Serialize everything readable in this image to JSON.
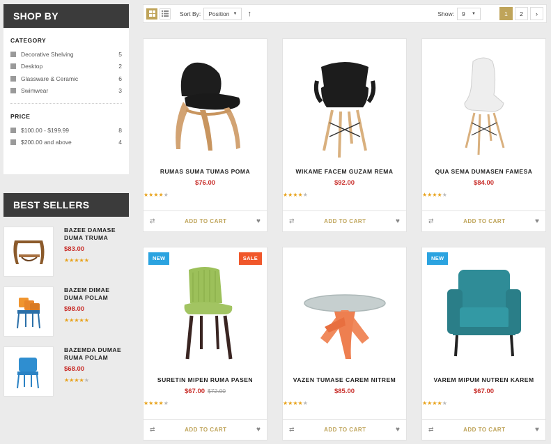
{
  "sidebar": {
    "shop_by_title": "SHOP BY",
    "category_heading": "CATEGORY",
    "categories": [
      {
        "label": "Decorative Shelving",
        "count": "5"
      },
      {
        "label": "Desktop",
        "count": "2"
      },
      {
        "label": "Glassware & Ceramic",
        "count": "6"
      },
      {
        "label": "Swimwear",
        "count": "3"
      }
    ],
    "price_heading": "PRICE",
    "prices": [
      {
        "label": "$100.00 - $199.99",
        "count": "8"
      },
      {
        "label": "$200.00 and above",
        "count": "4"
      }
    ],
    "best_sellers_title": "BEST SELLERS",
    "best_sellers": [
      {
        "name": "BAZEE DAMASE DUMA TRUMA",
        "price": "$83.00",
        "rating": 5
      },
      {
        "name": "BAZEM DIMAE DUMA POLAM",
        "price": "$98.00",
        "rating": 5
      },
      {
        "name": "BAZEMDA DUMAE RUMA POLAM",
        "price": "$68.00",
        "rating": 4
      }
    ]
  },
  "toolbar": {
    "sort_label": "Sort By:",
    "sort_value": "Position",
    "show_label": "Show:",
    "show_value": "9",
    "pages": [
      "1",
      "2"
    ],
    "current_page": "1",
    "next_icon": "chevron-right-icon"
  },
  "colors": {
    "accent": "#bfa45a",
    "price": "#c9302c",
    "new_badge": "#2ba3e0",
    "sale_badge": "#f0572b",
    "star": "#e8a21a"
  },
  "products": [
    {
      "name": "RUMAS SUMA TUMAS POMA",
      "price": "$76.00",
      "old_price": "",
      "rating": 4,
      "badge_new": "",
      "badge_sale": ""
    },
    {
      "name": "WIKAME FACEM GUZAM REMA",
      "price": "$92.00",
      "old_price": "",
      "rating": 4,
      "badge_new": "",
      "badge_sale": ""
    },
    {
      "name": "QUA SEMA DUMASEN FAMESA",
      "price": "$84.00",
      "old_price": "",
      "rating": 4,
      "badge_new": "",
      "badge_sale": ""
    },
    {
      "name": "SURETIN MIPEN RUMA PASEN",
      "price": "$67.00",
      "old_price": "$72.00",
      "rating": 4,
      "badge_new": "NEW",
      "badge_sale": "SALE"
    },
    {
      "name": "VAZEN TUMASE CAREM NITREM",
      "price": "$85.00",
      "old_price": "",
      "rating": 4,
      "badge_new": "",
      "badge_sale": ""
    },
    {
      "name": "VAREM MIPUM NUTREN KAREM",
      "price": "$67.00",
      "old_price": "",
      "rating": 4,
      "badge_new": "NEW",
      "badge_sale": ""
    }
  ],
  "add_to_cart_label": "ADD TO CART"
}
